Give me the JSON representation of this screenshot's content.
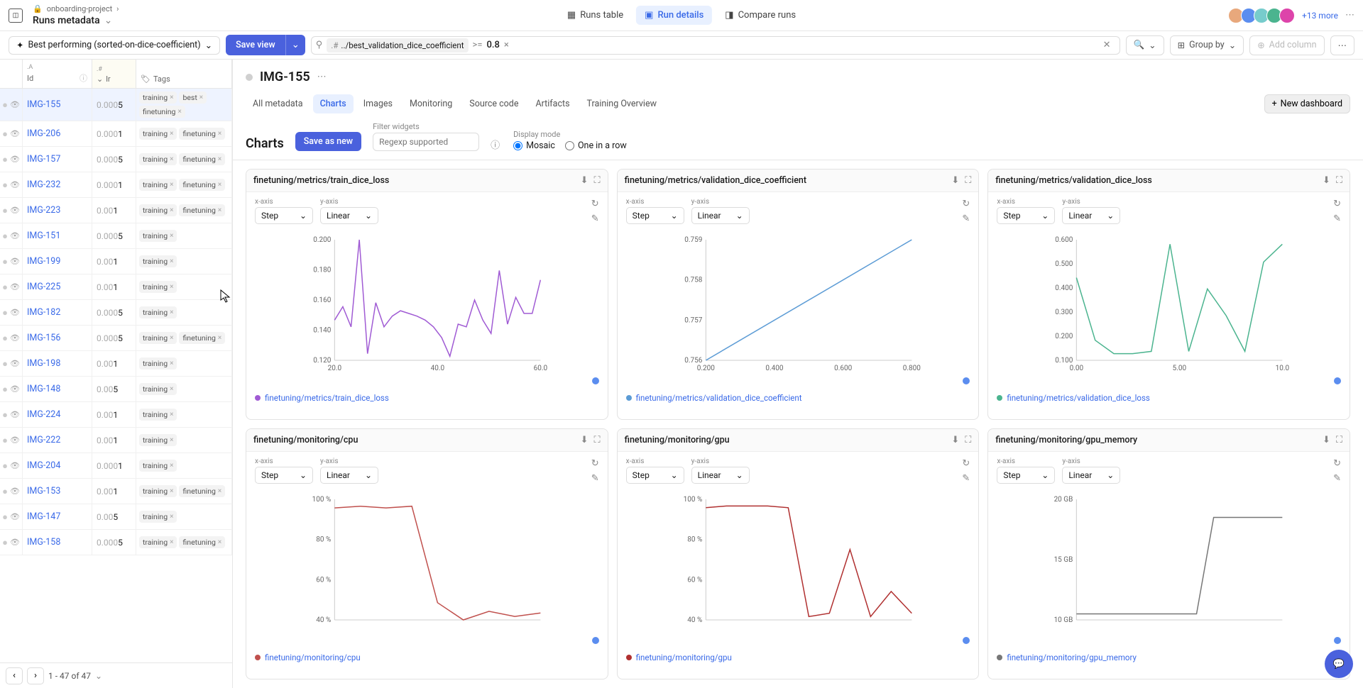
{
  "breadcrumb": {
    "project": "onboarding-project",
    "page": "Runs metadata"
  },
  "nav": {
    "runs_table": "Runs table",
    "run_details": "Run details",
    "compare_runs": "Compare runs"
  },
  "collab": {
    "more": "+13 more"
  },
  "filter_bar": {
    "sort_chip": "Best performing (sorted-on-dice-coefficient)",
    "save_view": "Save view",
    "filter": {
      "path": "../best_validation_dice_coefficient",
      "op": ">=",
      "val": "0.8"
    },
    "group_by": "Group by",
    "add_column": "Add column"
  },
  "table": {
    "headers": {
      "id": "Id",
      "lr": "lr",
      "tags": "Tags"
    },
    "rows": [
      {
        "id": "IMG-155",
        "lr": "0.0005",
        "tags": [
          "training",
          "best",
          "finetuning"
        ],
        "selected": true
      },
      {
        "id": "IMG-206",
        "lr": "0.0001",
        "tags": [
          "training",
          "finetuning"
        ]
      },
      {
        "id": "IMG-157",
        "lr": "0.0005",
        "tags": [
          "training",
          "finetuning"
        ]
      },
      {
        "id": "IMG-232",
        "lr": "0.0001",
        "tags": [
          "training",
          "finetuning"
        ]
      },
      {
        "id": "IMG-223",
        "lr": "0.001",
        "tags": [
          "training",
          "finetuning"
        ]
      },
      {
        "id": "IMG-151",
        "lr": "0.0005",
        "tags": [
          "training"
        ]
      },
      {
        "id": "IMG-199",
        "lr": "0.001",
        "tags": [
          "training"
        ]
      },
      {
        "id": "IMG-225",
        "lr": "0.001",
        "tags": [
          "training"
        ]
      },
      {
        "id": "IMG-182",
        "lr": "0.0005",
        "tags": [
          "training"
        ]
      },
      {
        "id": "IMG-156",
        "lr": "0.0005",
        "tags": [
          "training",
          "finetuning"
        ]
      },
      {
        "id": "IMG-198",
        "lr": "0.001",
        "tags": [
          "training"
        ]
      },
      {
        "id": "IMG-148",
        "lr": "0.005",
        "tags": [
          "training"
        ]
      },
      {
        "id": "IMG-224",
        "lr": "0.001",
        "tags": [
          "training"
        ]
      },
      {
        "id": "IMG-222",
        "lr": "0.001",
        "tags": [
          "training"
        ]
      },
      {
        "id": "IMG-204",
        "lr": "0.0001",
        "tags": [
          "training"
        ]
      },
      {
        "id": "IMG-153",
        "lr": "0.001",
        "tags": [
          "training",
          "finetuning"
        ]
      },
      {
        "id": "IMG-147",
        "lr": "0.005",
        "tags": [
          "training"
        ]
      },
      {
        "id": "IMG-158",
        "lr": "0.0005",
        "tags": [
          "training",
          "finetuning"
        ]
      }
    ],
    "footer": "1 - 47 of 47"
  },
  "detail": {
    "title": "IMG-155",
    "tabs": [
      "All metadata",
      "Charts",
      "Images",
      "Monitoring",
      "Source code",
      "Artifacts",
      "Training Overview"
    ],
    "active_tab": "Charts",
    "new_dashboard": "New dashboard",
    "charts_heading": "Charts",
    "save_as_new": "Save as new",
    "filter_widgets_label": "Filter widgets",
    "filter_widgets_placeholder": "Regexp supported",
    "display_mode_label": "Display mode",
    "mode_mosaic": "Mosaic",
    "mode_row": "One in a row",
    "x_axis_label": "x-axis",
    "y_axis_label": "y-axis",
    "x_axis_value": "Step",
    "y_axis_value": "Linear"
  },
  "charts": [
    {
      "title": "finetuning/metrics/train_dice_loss",
      "legend": "finetuning/metrics/train_dice_loss",
      "color": "#a05bd4"
    },
    {
      "title": "finetuning/metrics/validation_dice_coefficient",
      "legend": "finetuning/metrics/validation_dice_coefficient",
      "color": "#5b9bd5"
    },
    {
      "title": "finetuning/metrics/validation_dice_loss",
      "legend": "finetuning/metrics/validation_dice_loss",
      "color": "#4bb48f"
    },
    {
      "title": "finetuning/monitoring/cpu",
      "legend": "finetuning/monitoring/cpu",
      "color": "#c0504d"
    },
    {
      "title": "finetuning/monitoring/gpu",
      "legend": "finetuning/monitoring/gpu",
      "color": "#b03030"
    },
    {
      "title": "finetuning/monitoring/gpu_memory",
      "legend": "finetuning/monitoring/gpu_memory",
      "color": "#777"
    }
  ],
  "chart_data": [
    {
      "type": "line",
      "title": "finetuning/metrics/train_dice_loss",
      "xlabel": "Step",
      "ylabel": "",
      "x_ticks": [
        "20.0",
        "40.0",
        "60.0"
      ],
      "y_ticks": [
        "0.120",
        "0.140",
        "0.160",
        "0.180",
        "0.200"
      ],
      "x": [
        10,
        12,
        14,
        16,
        18,
        20,
        22,
        24,
        26,
        28,
        30,
        32,
        34,
        36,
        38,
        40,
        42,
        44,
        46,
        48,
        50,
        52,
        54,
        56,
        58,
        60
      ],
      "y": [
        0.145,
        0.155,
        0.14,
        0.205,
        0.12,
        0.158,
        0.14,
        0.148,
        0.152,
        0.15,
        0.148,
        0.145,
        0.14,
        0.132,
        0.118,
        0.142,
        0.14,
        0.16,
        0.145,
        0.135,
        0.182,
        0.142,
        0.162,
        0.15,
        0.15,
        0.175
      ],
      "xlim": [
        10,
        60
      ],
      "ylim": [
        0.115,
        0.205
      ]
    },
    {
      "type": "line",
      "title": "finetuning/metrics/validation_dice_coefficient",
      "xlabel": "Step",
      "ylabel": "",
      "x_ticks": [
        "0.200",
        "0.400",
        "0.600",
        "0.800"
      ],
      "y_ticks": [
        "0.756",
        "0.757",
        "0.758",
        "0.759"
      ],
      "x": [
        0.0,
        1.0
      ],
      "y": [
        0.756,
        0.7595
      ],
      "xlim": [
        0,
        1
      ],
      "ylim": [
        0.756,
        0.7595
      ]
    },
    {
      "type": "line",
      "title": "finetuning/metrics/validation_dice_loss",
      "xlabel": "Step",
      "ylabel": "",
      "x_ticks": [
        "0.00",
        "5.00",
        "10.0"
      ],
      "y_ticks": [
        "0.100",
        "0.200",
        "0.300",
        "0.400",
        "0.500",
        "0.600"
      ],
      "x": [
        0,
        1,
        2,
        3,
        4,
        5,
        6,
        7,
        8,
        9,
        10,
        11
      ],
      "y": [
        0.45,
        0.17,
        0.11,
        0.11,
        0.12,
        0.6,
        0.12,
        0.4,
        0.28,
        0.12,
        0.52,
        0.6
      ],
      "xlim": [
        0,
        11
      ],
      "ylim": [
        0.08,
        0.62
      ]
    },
    {
      "type": "line",
      "title": "finetuning/monitoring/cpu",
      "xlabel": "Step",
      "ylabel": "%",
      "x_ticks": [],
      "y_ticks": [
        "40 %",
        "60 %",
        "80 %",
        "100 %"
      ],
      "x": [
        0,
        1,
        2,
        3,
        4,
        5,
        6,
        7,
        8
      ],
      "y": [
        95,
        96,
        95,
        96,
        40,
        30,
        35,
        32,
        34
      ],
      "xlim": [
        0,
        8
      ],
      "ylim": [
        30,
        100
      ]
    },
    {
      "type": "line",
      "title": "finetuning/monitoring/gpu",
      "xlabel": "Step",
      "ylabel": "%",
      "x_ticks": [],
      "y_ticks": [
        "40 %",
        "60 %",
        "80 %",
        "100 %"
      ],
      "x": [
        0,
        1,
        2,
        3,
        4,
        5,
        6,
        7,
        8,
        9,
        10
      ],
      "y": [
        95,
        96,
        96,
        96,
        95,
        30,
        32,
        70,
        30,
        45,
        32
      ],
      "xlim": [
        0,
        10
      ],
      "ylim": [
        28,
        100
      ]
    },
    {
      "type": "line",
      "title": "finetuning/monitoring/gpu_memory",
      "xlabel": "Step",
      "ylabel": "GB",
      "x_ticks": [],
      "y_ticks": [
        "10 GB",
        "15 GB",
        "20 GB"
      ],
      "x": [
        0,
        7,
        8,
        12
      ],
      "y": [
        3,
        3,
        19,
        19
      ],
      "xlim": [
        0,
        12
      ],
      "ylim": [
        2,
        22
      ]
    }
  ]
}
